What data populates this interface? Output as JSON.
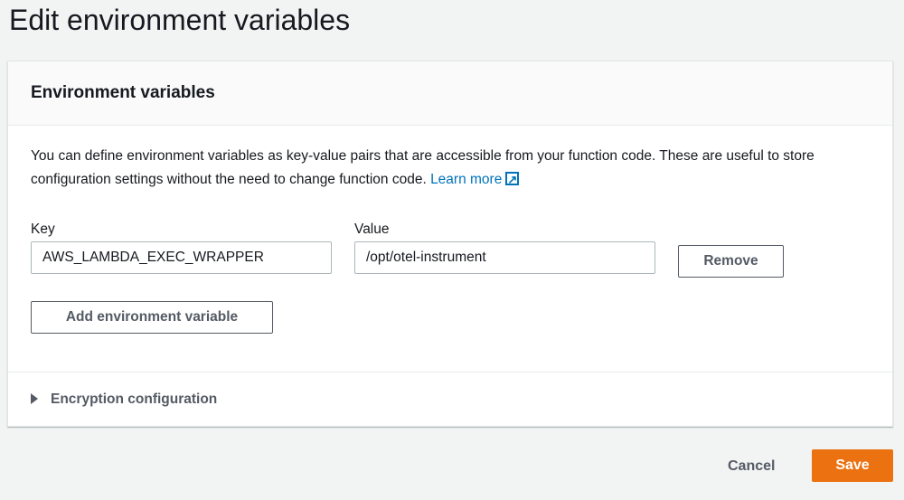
{
  "page_title": "Edit environment variables",
  "section": {
    "title": "Environment variables",
    "description": "You can define environment variables as key-value pairs that are accessible from your function code. These are useful to store configuration settings without the need to change function code.",
    "learn_more": "Learn more",
    "key_label": "Key",
    "value_label": "Value",
    "variables": [
      {
        "key": "AWS_LAMBDA_EXEC_WRAPPER",
        "value": "/opt/otel-instrument"
      }
    ],
    "remove_label": "Remove",
    "add_label": "Add environment variable",
    "encryption_label": "Encryption configuration"
  },
  "footer": {
    "cancel": "Cancel",
    "save": "Save"
  },
  "colors": {
    "accent": "#ec7211",
    "link": "#0073bb"
  }
}
